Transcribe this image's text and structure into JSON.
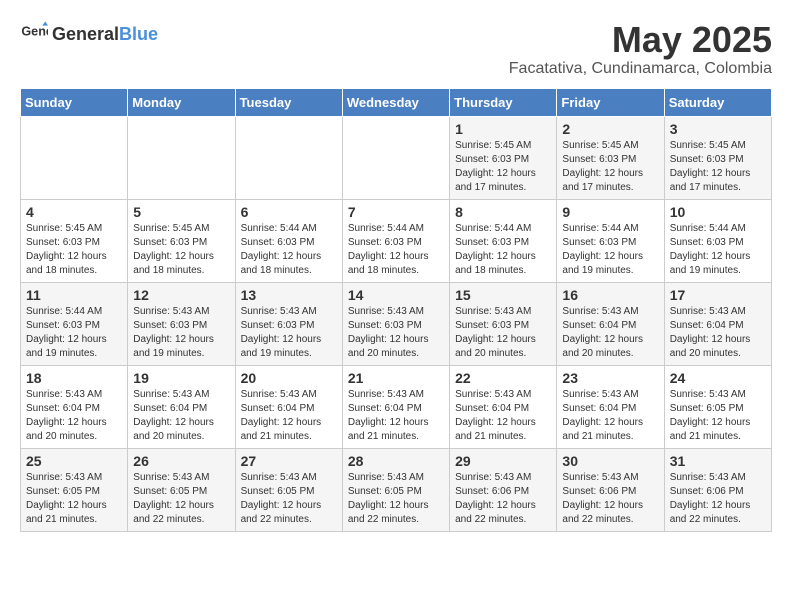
{
  "logo": {
    "general": "General",
    "blue": "Blue"
  },
  "title": "May 2025",
  "subtitle": "Facatativa, Cundinamarca, Colombia",
  "headers": [
    "Sunday",
    "Monday",
    "Tuesday",
    "Wednesday",
    "Thursday",
    "Friday",
    "Saturday"
  ],
  "weeks": [
    [
      {
        "day": "",
        "info": ""
      },
      {
        "day": "",
        "info": ""
      },
      {
        "day": "",
        "info": ""
      },
      {
        "day": "",
        "info": ""
      },
      {
        "day": "1",
        "info": "Sunrise: 5:45 AM\nSunset: 6:03 PM\nDaylight: 12 hours\nand 17 minutes."
      },
      {
        "day": "2",
        "info": "Sunrise: 5:45 AM\nSunset: 6:03 PM\nDaylight: 12 hours\nand 17 minutes."
      },
      {
        "day": "3",
        "info": "Sunrise: 5:45 AM\nSunset: 6:03 PM\nDaylight: 12 hours\nand 17 minutes."
      }
    ],
    [
      {
        "day": "4",
        "info": "Sunrise: 5:45 AM\nSunset: 6:03 PM\nDaylight: 12 hours\nand 18 minutes."
      },
      {
        "day": "5",
        "info": "Sunrise: 5:45 AM\nSunset: 6:03 PM\nDaylight: 12 hours\nand 18 minutes."
      },
      {
        "day": "6",
        "info": "Sunrise: 5:44 AM\nSunset: 6:03 PM\nDaylight: 12 hours\nand 18 minutes."
      },
      {
        "day": "7",
        "info": "Sunrise: 5:44 AM\nSunset: 6:03 PM\nDaylight: 12 hours\nand 18 minutes."
      },
      {
        "day": "8",
        "info": "Sunrise: 5:44 AM\nSunset: 6:03 PM\nDaylight: 12 hours\nand 18 minutes."
      },
      {
        "day": "9",
        "info": "Sunrise: 5:44 AM\nSunset: 6:03 PM\nDaylight: 12 hours\nand 19 minutes."
      },
      {
        "day": "10",
        "info": "Sunrise: 5:44 AM\nSunset: 6:03 PM\nDaylight: 12 hours\nand 19 minutes."
      }
    ],
    [
      {
        "day": "11",
        "info": "Sunrise: 5:44 AM\nSunset: 6:03 PM\nDaylight: 12 hours\nand 19 minutes."
      },
      {
        "day": "12",
        "info": "Sunrise: 5:43 AM\nSunset: 6:03 PM\nDaylight: 12 hours\nand 19 minutes."
      },
      {
        "day": "13",
        "info": "Sunrise: 5:43 AM\nSunset: 6:03 PM\nDaylight: 12 hours\nand 19 minutes."
      },
      {
        "day": "14",
        "info": "Sunrise: 5:43 AM\nSunset: 6:03 PM\nDaylight: 12 hours\nand 20 minutes."
      },
      {
        "day": "15",
        "info": "Sunrise: 5:43 AM\nSunset: 6:03 PM\nDaylight: 12 hours\nand 20 minutes."
      },
      {
        "day": "16",
        "info": "Sunrise: 5:43 AM\nSunset: 6:04 PM\nDaylight: 12 hours\nand 20 minutes."
      },
      {
        "day": "17",
        "info": "Sunrise: 5:43 AM\nSunset: 6:04 PM\nDaylight: 12 hours\nand 20 minutes."
      }
    ],
    [
      {
        "day": "18",
        "info": "Sunrise: 5:43 AM\nSunset: 6:04 PM\nDaylight: 12 hours\nand 20 minutes."
      },
      {
        "day": "19",
        "info": "Sunrise: 5:43 AM\nSunset: 6:04 PM\nDaylight: 12 hours\nand 20 minutes."
      },
      {
        "day": "20",
        "info": "Sunrise: 5:43 AM\nSunset: 6:04 PM\nDaylight: 12 hours\nand 21 minutes."
      },
      {
        "day": "21",
        "info": "Sunrise: 5:43 AM\nSunset: 6:04 PM\nDaylight: 12 hours\nand 21 minutes."
      },
      {
        "day": "22",
        "info": "Sunrise: 5:43 AM\nSunset: 6:04 PM\nDaylight: 12 hours\nand 21 minutes."
      },
      {
        "day": "23",
        "info": "Sunrise: 5:43 AM\nSunset: 6:04 PM\nDaylight: 12 hours\nand 21 minutes."
      },
      {
        "day": "24",
        "info": "Sunrise: 5:43 AM\nSunset: 6:05 PM\nDaylight: 12 hours\nand 21 minutes."
      }
    ],
    [
      {
        "day": "25",
        "info": "Sunrise: 5:43 AM\nSunset: 6:05 PM\nDaylight: 12 hours\nand 21 minutes."
      },
      {
        "day": "26",
        "info": "Sunrise: 5:43 AM\nSunset: 6:05 PM\nDaylight: 12 hours\nand 22 minutes."
      },
      {
        "day": "27",
        "info": "Sunrise: 5:43 AM\nSunset: 6:05 PM\nDaylight: 12 hours\nand 22 minutes."
      },
      {
        "day": "28",
        "info": "Sunrise: 5:43 AM\nSunset: 6:05 PM\nDaylight: 12 hours\nand 22 minutes."
      },
      {
        "day": "29",
        "info": "Sunrise: 5:43 AM\nSunset: 6:06 PM\nDaylight: 12 hours\nand 22 minutes."
      },
      {
        "day": "30",
        "info": "Sunrise: 5:43 AM\nSunset: 6:06 PM\nDaylight: 12 hours\nand 22 minutes."
      },
      {
        "day": "31",
        "info": "Sunrise: 5:43 AM\nSunset: 6:06 PM\nDaylight: 12 hours\nand 22 minutes."
      }
    ]
  ]
}
